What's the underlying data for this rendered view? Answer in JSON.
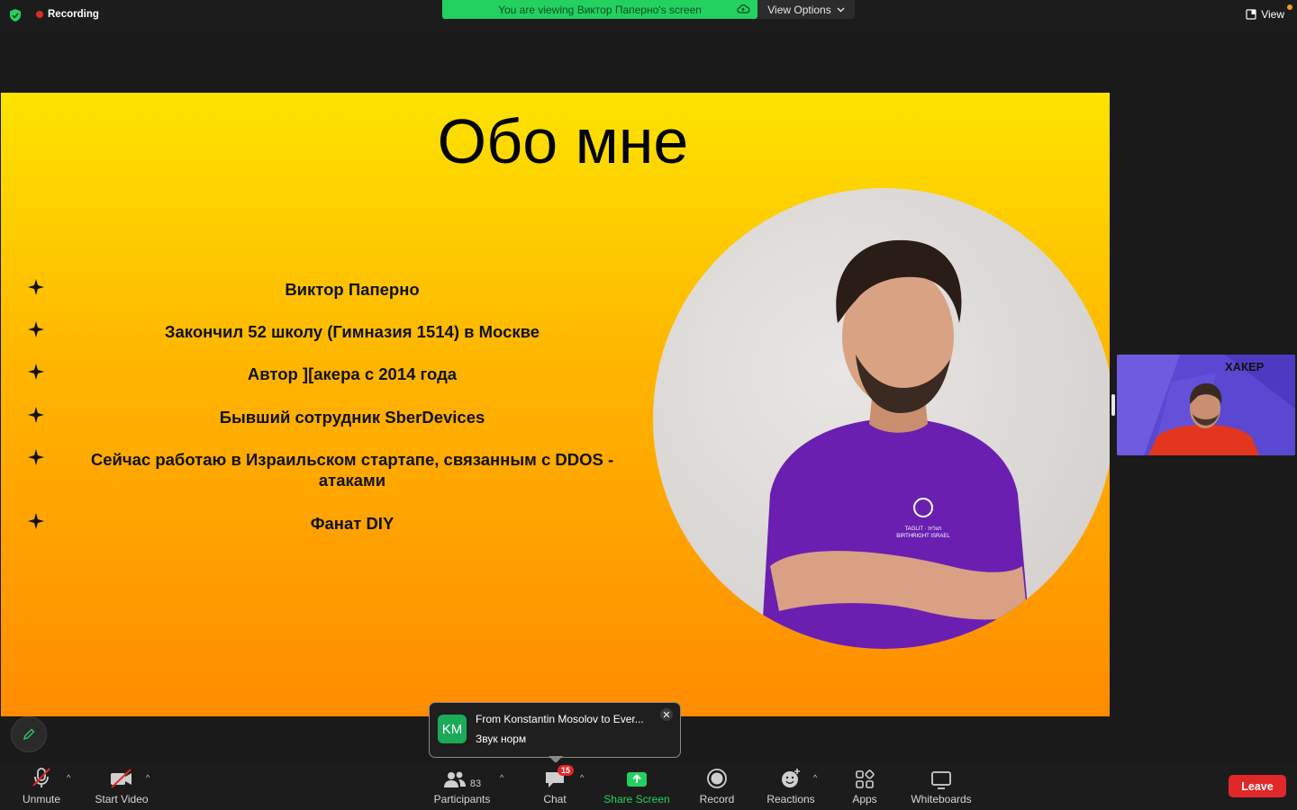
{
  "topbar": {
    "recording_label": "Recording",
    "viewing_label": "You are viewing Виктор Паперно's screen",
    "view_options_label": "View Options",
    "view_label": "View"
  },
  "slide": {
    "title": "Обо мне",
    "bullets": [
      "Виктор Паперно",
      "Закончил 52 школу (Гимназия 1514) в Москве",
      "Автор ][акера с 2014 года",
      "Бывший сотрудник SberDevices",
      "Сейчас работаю в Израильском стартапе, связанным с DDOS - атаками",
      "Фанат DIY"
    ],
    "shirt_text_line1": "TAGLIT · תגלית",
    "shirt_text_line2": "BIRTHRIGHT ISRAEL"
  },
  "thumbnail": {
    "logo_text": "ХАКЕР"
  },
  "chat_toast": {
    "avatar_initials": "KM",
    "from": "From Konstantin Mosolov to Ever...",
    "message": "Звук норм"
  },
  "toolbar": {
    "unmute_label": "Unmute",
    "start_video_label": "Start Video",
    "participants_label": "Participants",
    "participants_count": "83",
    "chat_label": "Chat",
    "chat_badge": "15",
    "share_screen_label": "Share Screen",
    "record_label": "Record",
    "reactions_label": "Reactions",
    "apps_label": "Apps",
    "whiteboards_label": "Whiteboards",
    "leave_label": "Leave"
  },
  "colors": {
    "accent_green": "#23d160",
    "leave_red": "#e02828",
    "slide_top": "#fde300",
    "slide_bottom": "#ff8c00"
  }
}
